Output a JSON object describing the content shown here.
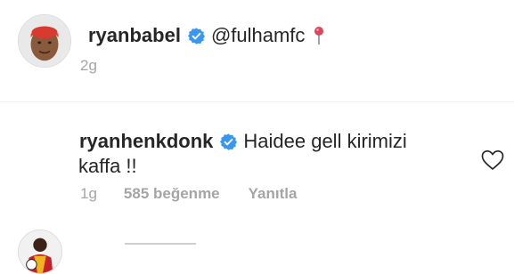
{
  "caption": {
    "username": "ryanbabel",
    "mention": "@fulhamfc",
    "pin_emoji": "📍",
    "timestamp": "2g"
  },
  "comment": {
    "username": "ryanhenkdonk",
    "text_line1": "Haidee gell kirimizi",
    "text_line2": "kaffa !!",
    "timestamp": "1g",
    "likes": "585 beğenme",
    "reply_label": "Yanıtla"
  },
  "icons": {
    "verified": "verified-badge-icon",
    "pin": "round-pushpin-icon",
    "heart": "heart-outline-icon"
  },
  "colors": {
    "verified_blue": "#3897f0",
    "text_primary": "#262626",
    "text_secondary": "#a5a5a5",
    "pin_red": "#e0445b"
  }
}
